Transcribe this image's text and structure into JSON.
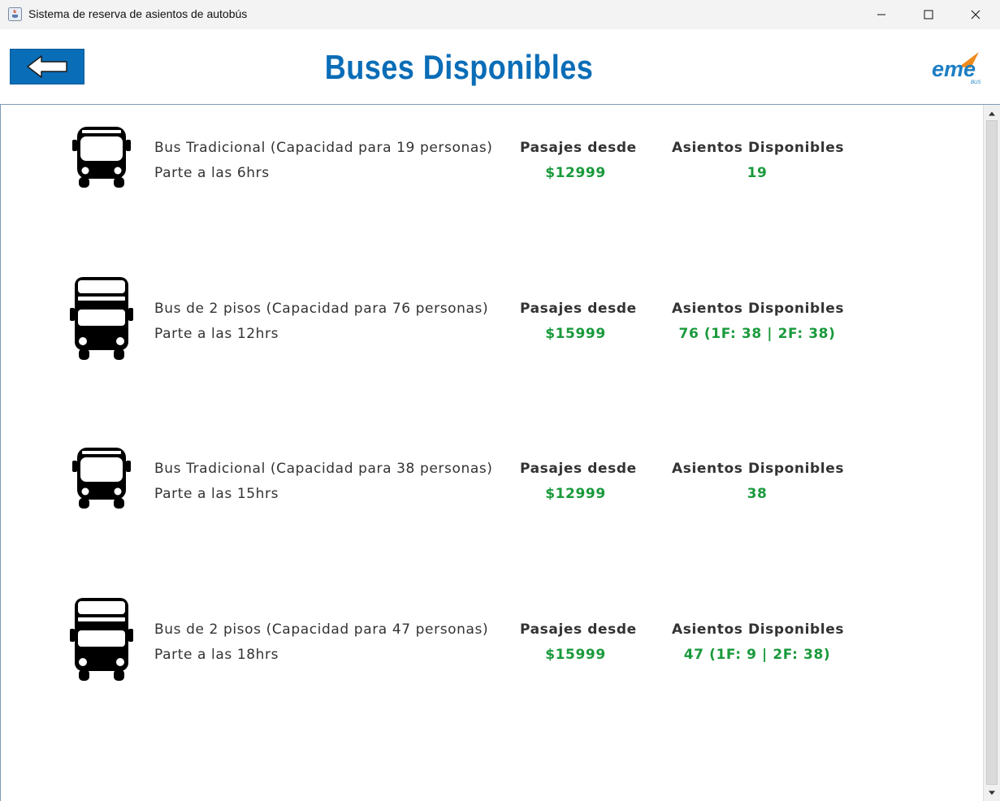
{
  "window": {
    "title": "Sistema de reserva de asientos de autobús",
    "controls": [
      "minimize",
      "maximize",
      "close"
    ]
  },
  "header": {
    "title": "Buses Disponibles",
    "back_icon": "left-arrow-icon",
    "logo_text": "eme",
    "logo_subtext": "BUS",
    "colors": {
      "title": "#0a6db7",
      "back_button": "#0a6db7",
      "logo_accent": "#f08a1c"
    }
  },
  "buses": [
    {
      "type_icon": "single-deck-bus-icon",
      "description": "Bus Tradicional (Capacidad para 19 personas)",
      "departure": "Parte a las 6hrs",
      "price_label": "Pasajes desde",
      "price": "$12999",
      "seats_label": "Asientos Disponibles",
      "seats": "19"
    },
    {
      "type_icon": "double-deck-bus-icon",
      "description": "Bus de 2 pisos (Capacidad para 76 personas)",
      "departure": "Parte a las 12hrs",
      "price_label": "Pasajes desde",
      "price": "$15999",
      "seats_label": "Asientos Disponibles",
      "seats": "76 (1F: 38 | 2F: 38)"
    },
    {
      "type_icon": "single-deck-bus-icon",
      "description": "Bus Tradicional (Capacidad para 38 personas)",
      "departure": "Parte a las 15hrs",
      "price_label": "Pasajes desde",
      "price": "$12999",
      "seats_label": "Asientos Disponibles",
      "seats": "38"
    },
    {
      "type_icon": "double-deck-bus-icon",
      "description": "Bus de 2 pisos (Capacidad para 47 personas)",
      "departure": "Parte a las 18hrs",
      "price_label": "Pasajes desde",
      "price": "$15999",
      "seats_label": "Asientos Disponibles",
      "seats": "47 (1F: 9 | 2F: 38)"
    }
  ],
  "colors": {
    "value_green": "#1a9a3c",
    "label_text": "#333333"
  }
}
